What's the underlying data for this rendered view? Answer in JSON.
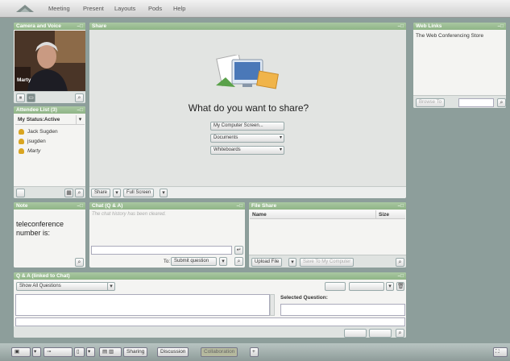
{
  "menubar": {
    "items": [
      "Meeting",
      "Present",
      "Layouts",
      "Pods",
      "Help"
    ]
  },
  "camera_pod": {
    "title": "Camera and Voice",
    "presenter_name": "Marty"
  },
  "attendee_pod": {
    "title": "Attendee List (3)",
    "status": "My Status:Active",
    "attendees": [
      "Jack Sugden",
      "jsugden",
      "Marty"
    ]
  },
  "share_pod": {
    "title": "Share",
    "prompt": "What do you want to share?",
    "options": [
      "My Computer Screen...",
      "Documents",
      "Whiteboards"
    ],
    "footer_share": "Share",
    "footer_fullscreen": "Full Screen"
  },
  "weblinks_pod": {
    "title": "Web Links",
    "content": "The Web Conferencing Store",
    "browse_label": "Browse To"
  },
  "note_pod": {
    "title": "Note",
    "text": "teleconference number is:"
  },
  "chat_pod": {
    "title": "Chat (Q & A)",
    "history_msg": "The chat history has been cleared.",
    "to_label": "To:",
    "to_value": "Submit question"
  },
  "fileshare_pod": {
    "title": "File Share",
    "col_name": "Name",
    "col_size": "Size",
    "upload_label": "Upload File",
    "save_label": "Save To My Computer"
  },
  "qa_pod": {
    "title": "Q & A (linked to Chat)",
    "filter": "Show All Questions",
    "selected_label": "Selected Question:"
  },
  "taskbar": {
    "tab_sharing": "Sharing",
    "tab_discussion": "Discussion",
    "tab_collaboration": "Collaboration",
    "add_label": "+"
  }
}
